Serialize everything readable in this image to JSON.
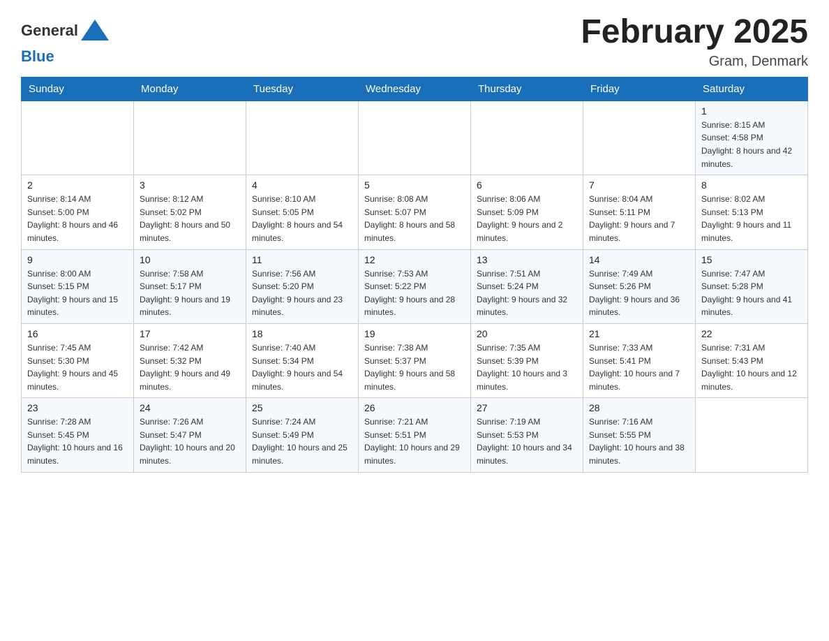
{
  "header": {
    "title": "February 2025",
    "location": "Gram, Denmark",
    "logo_general": "General",
    "logo_blue": "Blue"
  },
  "days_of_week": [
    "Sunday",
    "Monday",
    "Tuesday",
    "Wednesday",
    "Thursday",
    "Friday",
    "Saturday"
  ],
  "weeks": [
    [
      {
        "day": "",
        "info": ""
      },
      {
        "day": "",
        "info": ""
      },
      {
        "day": "",
        "info": ""
      },
      {
        "day": "",
        "info": ""
      },
      {
        "day": "",
        "info": ""
      },
      {
        "day": "",
        "info": ""
      },
      {
        "day": "1",
        "info": "Sunrise: 8:15 AM\nSunset: 4:58 PM\nDaylight: 8 hours and 42 minutes."
      }
    ],
    [
      {
        "day": "2",
        "info": "Sunrise: 8:14 AM\nSunset: 5:00 PM\nDaylight: 8 hours and 46 minutes."
      },
      {
        "day": "3",
        "info": "Sunrise: 8:12 AM\nSunset: 5:02 PM\nDaylight: 8 hours and 50 minutes."
      },
      {
        "day": "4",
        "info": "Sunrise: 8:10 AM\nSunset: 5:05 PM\nDaylight: 8 hours and 54 minutes."
      },
      {
        "day": "5",
        "info": "Sunrise: 8:08 AM\nSunset: 5:07 PM\nDaylight: 8 hours and 58 minutes."
      },
      {
        "day": "6",
        "info": "Sunrise: 8:06 AM\nSunset: 5:09 PM\nDaylight: 9 hours and 2 minutes."
      },
      {
        "day": "7",
        "info": "Sunrise: 8:04 AM\nSunset: 5:11 PM\nDaylight: 9 hours and 7 minutes."
      },
      {
        "day": "8",
        "info": "Sunrise: 8:02 AM\nSunset: 5:13 PM\nDaylight: 9 hours and 11 minutes."
      }
    ],
    [
      {
        "day": "9",
        "info": "Sunrise: 8:00 AM\nSunset: 5:15 PM\nDaylight: 9 hours and 15 minutes."
      },
      {
        "day": "10",
        "info": "Sunrise: 7:58 AM\nSunset: 5:17 PM\nDaylight: 9 hours and 19 minutes."
      },
      {
        "day": "11",
        "info": "Sunrise: 7:56 AM\nSunset: 5:20 PM\nDaylight: 9 hours and 23 minutes."
      },
      {
        "day": "12",
        "info": "Sunrise: 7:53 AM\nSunset: 5:22 PM\nDaylight: 9 hours and 28 minutes."
      },
      {
        "day": "13",
        "info": "Sunrise: 7:51 AM\nSunset: 5:24 PM\nDaylight: 9 hours and 32 minutes."
      },
      {
        "day": "14",
        "info": "Sunrise: 7:49 AM\nSunset: 5:26 PM\nDaylight: 9 hours and 36 minutes."
      },
      {
        "day": "15",
        "info": "Sunrise: 7:47 AM\nSunset: 5:28 PM\nDaylight: 9 hours and 41 minutes."
      }
    ],
    [
      {
        "day": "16",
        "info": "Sunrise: 7:45 AM\nSunset: 5:30 PM\nDaylight: 9 hours and 45 minutes."
      },
      {
        "day": "17",
        "info": "Sunrise: 7:42 AM\nSunset: 5:32 PM\nDaylight: 9 hours and 49 minutes."
      },
      {
        "day": "18",
        "info": "Sunrise: 7:40 AM\nSunset: 5:34 PM\nDaylight: 9 hours and 54 minutes."
      },
      {
        "day": "19",
        "info": "Sunrise: 7:38 AM\nSunset: 5:37 PM\nDaylight: 9 hours and 58 minutes."
      },
      {
        "day": "20",
        "info": "Sunrise: 7:35 AM\nSunset: 5:39 PM\nDaylight: 10 hours and 3 minutes."
      },
      {
        "day": "21",
        "info": "Sunrise: 7:33 AM\nSunset: 5:41 PM\nDaylight: 10 hours and 7 minutes."
      },
      {
        "day": "22",
        "info": "Sunrise: 7:31 AM\nSunset: 5:43 PM\nDaylight: 10 hours and 12 minutes."
      }
    ],
    [
      {
        "day": "23",
        "info": "Sunrise: 7:28 AM\nSunset: 5:45 PM\nDaylight: 10 hours and 16 minutes."
      },
      {
        "day": "24",
        "info": "Sunrise: 7:26 AM\nSunset: 5:47 PM\nDaylight: 10 hours and 20 minutes."
      },
      {
        "day": "25",
        "info": "Sunrise: 7:24 AM\nSunset: 5:49 PM\nDaylight: 10 hours and 25 minutes."
      },
      {
        "day": "26",
        "info": "Sunrise: 7:21 AM\nSunset: 5:51 PM\nDaylight: 10 hours and 29 minutes."
      },
      {
        "day": "27",
        "info": "Sunrise: 7:19 AM\nSunset: 5:53 PM\nDaylight: 10 hours and 34 minutes."
      },
      {
        "day": "28",
        "info": "Sunrise: 7:16 AM\nSunset: 5:55 PM\nDaylight: 10 hours and 38 minutes."
      },
      {
        "day": "",
        "info": ""
      }
    ]
  ]
}
